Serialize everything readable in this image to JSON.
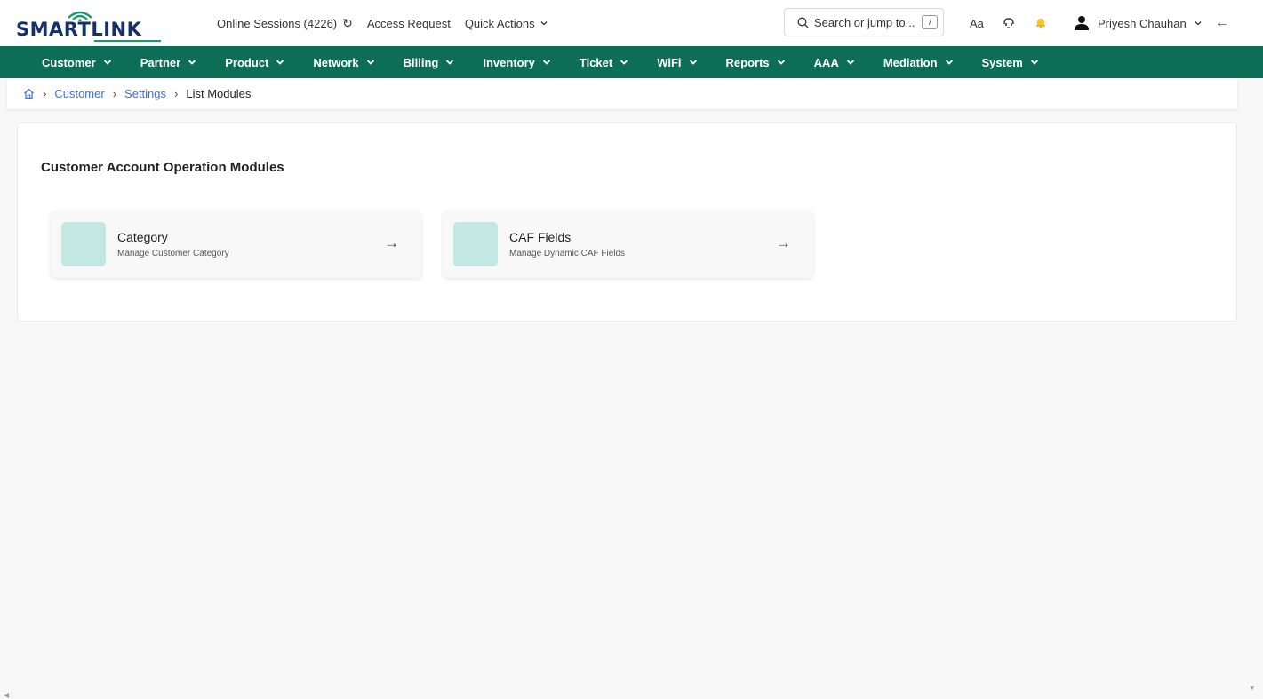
{
  "brand": {
    "name": "SMARTLINK",
    "accent": "#0d6e57",
    "logo_color": "#14306b"
  },
  "header": {
    "online_sessions": "Online Sessions (4226)",
    "access_request": "Access Request",
    "quick_actions": "Quick Actions",
    "search_placeholder": "Search or jump to...",
    "search_shortcut": "/",
    "font_toggle": "Aa",
    "user_name": "Priyesh Chauhan"
  },
  "nav": {
    "items": [
      "Customer",
      "Partner",
      "Product",
      "Network",
      "Billing",
      "Inventory",
      "Ticket",
      "WiFi",
      "Reports",
      "AAA",
      "Mediation",
      "System"
    ]
  },
  "breadcrumb": {
    "items": [
      "Customer",
      "Settings"
    ],
    "current": "List Modules"
  },
  "main": {
    "title": "Customer Account Operation Modules",
    "modules": [
      {
        "title": "Category",
        "description": "Manage Customer Category",
        "thumb_color": "#c3e7e3"
      },
      {
        "title": "CAF Fields",
        "description": "Manage Dynamic CAF Fields",
        "thumb_color": "#c3e7e3"
      }
    ]
  },
  "icons": {
    "refresh": "refresh-icon",
    "search": "search-icon",
    "support": "support-icon",
    "notification": "notification-icon",
    "user": "user-icon",
    "back": "back-arrow-icon",
    "home": "home-icon"
  }
}
